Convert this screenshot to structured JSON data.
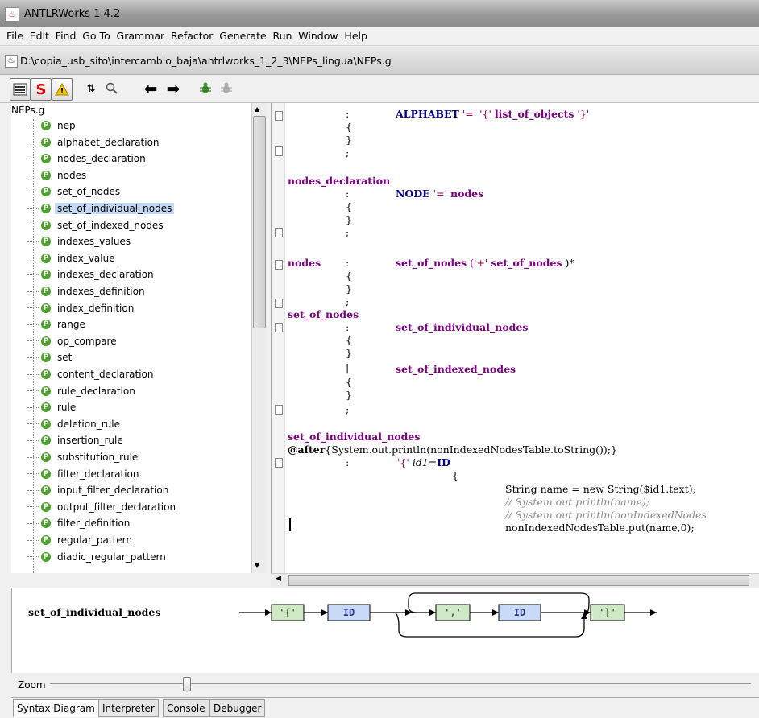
{
  "window": {
    "title": "ANTLRWorks 1.4.2"
  },
  "menu": [
    "File",
    "Edit",
    "Find",
    "Go To",
    "Grammar",
    "Refactor",
    "Generate",
    "Run",
    "Window",
    "Help"
  ],
  "file_path": "D:\\copia_usb_sito\\intercambio_baja\\antrlworks_1_2_3\\NEPs_lingua\\NEPs.g",
  "toolbar": {
    "s_label": "S",
    "warn_label": "!"
  },
  "tree": {
    "root": "NEPs.g",
    "items": [
      "nep",
      "alphabet_declaration",
      "nodes_declaration",
      "nodes",
      "set_of_nodes",
      "set_of_individual_nodes",
      "set_of_indexed_nodes",
      "indexes_values",
      "index_value",
      "indexes_declaration",
      "indexes_definition",
      "index_definition",
      "range",
      "op_compare",
      "set",
      "content_declaration",
      "rule_declaration",
      "rule",
      "deletion_rule",
      "insertion_rule",
      "substitution_rule",
      "filter_declaration",
      "input_filter_declaration",
      "output_filter_declaration",
      "filter_definition",
      "regular_pattern",
      "diadic_regular_pattern"
    ],
    "selected": "set_of_individual_nodes",
    "item_badge": "P"
  },
  "code": {
    "alphabet_body": "ALPHABET",
    "eq": "'='",
    "lbrace": "'{'",
    "list_of_objects": "list_of_objects",
    "rbrace": "'}'",
    "open_brace": "{",
    "close_brace": "}",
    "colon": ":",
    "semicolon": ";",
    "pipe": "|",
    "nodes_declaration": "nodes_declaration",
    "node_kw": "NODE",
    "nodes": "nodes",
    "set_of_nodes": "set_of_nodes",
    "plus": "('+'",
    "star": ")*",
    "set_of_individual_nodes": "set_of_individual_nodes",
    "set_of_indexed_nodes": "set_of_indexed_nodes",
    "after_kw": "@after",
    "after_body": "{System.out.println(nonIndexedNodesTable.toString());}",
    "id_line_lit": "'{'",
    "id_line_var": "id1",
    "id_line_eq": "=",
    "id_line_id": "ID",
    "java1": "String name = new String($id1.text);",
    "java2": "// System.out.println(name);",
    "java3": "// System.out.println(nonIndexedNodes",
    "java4": "nonIndexedNodesTable.put(name,0);"
  },
  "diagram": {
    "rule_name": "set_of_individual_nodes",
    "tokens": [
      "'{'",
      "ID",
      "','",
      "ID",
      "'}'"
    ]
  },
  "zoom": {
    "label": "Zoom",
    "value": 0.19
  },
  "bottom_tabs": [
    "Syntax Diagram",
    "Interpreter",
    "Console",
    "Debugger"
  ],
  "active_tab": "Syntax Diagram",
  "colors": {
    "keyword": "#000080",
    "rule": "#7a0080",
    "literal": "#a00060",
    "comment": "#888888",
    "selection": "#c3d9f5"
  }
}
